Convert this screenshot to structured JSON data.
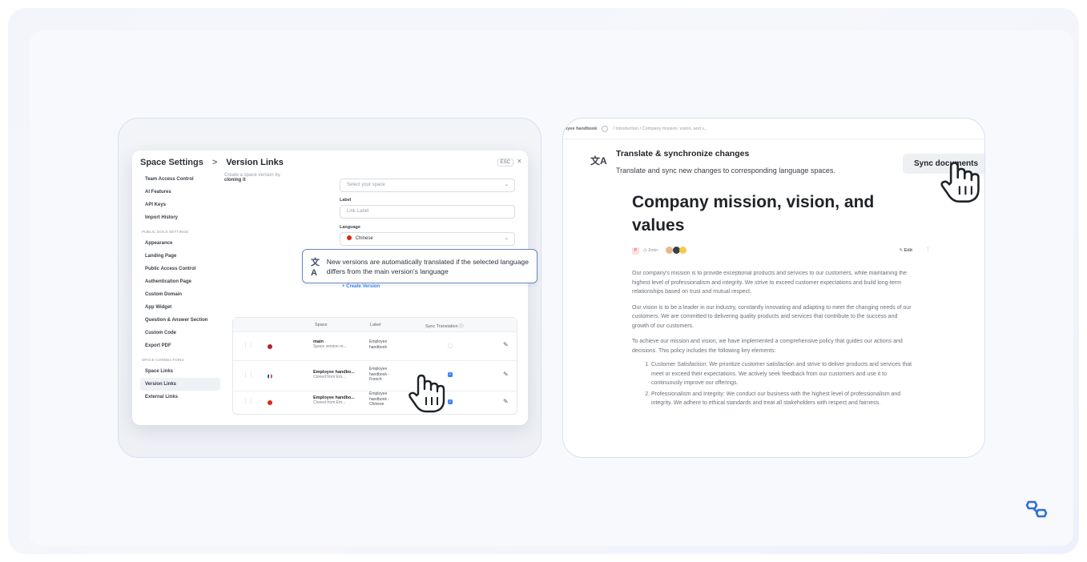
{
  "left": {
    "header": {
      "title": "Space Settings",
      "separator": ">",
      "subtitle": "Version Links",
      "esc": "ESC",
      "close": "×"
    },
    "sidebar": {
      "items_top": [
        "Team Access Control",
        "AI Features",
        "API Keys",
        "Import History"
      ],
      "group_public": "PUBLIC DOCS SETTINGS",
      "items_public": [
        "Appearance",
        "Landing Page",
        "Public Access Control",
        "Authentication Page",
        "Custom Domain",
        "App Widget",
        "Question & Answer Section",
        "Custom Code",
        "Export PDF"
      ],
      "group_connections": "SPACE CONNECTIONS",
      "items_connections": [
        "Space Links",
        "Version Links",
        "External Links"
      ]
    },
    "form": {
      "intro_faded": "Create a space version by",
      "intro": "cloning it",
      "space_placeholder": "Select your space",
      "label_title": "Label",
      "label_placeholder": "Link Label",
      "language_title": "Language",
      "language_value": "Chinese",
      "create_button": "+ Create Version"
    },
    "callout": {
      "text": "New versions are automatically translated if the selected language differs from the main version's language"
    },
    "table": {
      "headers": {
        "space": "Space",
        "label": "Label",
        "sync": "Sync Translation ⓘ"
      },
      "rows": [
        {
          "flag_color": "#b22234",
          "name": "main",
          "sub": "Space version re...",
          "label": "Employee handbook",
          "sync": false
        },
        {
          "flag_color": "#0055a4",
          "name": "Employee handbo...",
          "sub": "Cloned from Em...",
          "label": "Employee handbook - French",
          "sync": true
        },
        {
          "flag_color": "#de2910",
          "name": "Employee handbo...",
          "sub": "Cloned from Em...",
          "label": "Employee handbook - Chinese",
          "sync": true
        }
      ]
    }
  },
  "right": {
    "breadcrumb": {
      "first": "oyee handbook",
      "rest": "/ Introduction  / Company mission, vision, and v..."
    },
    "sync": {
      "title": "Translate & synchronize changes",
      "description": "Translate and sync new changes to corresponding language spaces.",
      "button": "Sync documents"
    },
    "doc": {
      "title": "Company mission, vision, and values",
      "badge": "P",
      "time": "◷ 2min",
      "edit": "✎ Edit",
      "more": "⋮",
      "para1": "Our company's mission is to provide exceptional products and services to our customers, while maintaining the highest level of professionalism and integrity. We strive to exceed customer expectations and build long-term relationships based on trust and mutual respect.",
      "para2": "Our vision is to be a leader in our industry, constantly innovating and adapting to meet the changing needs of our customers. We are committed to delivering quality products and services that contribute to the success and growth of our customers.",
      "para3": "To achieve our mission and vision, we have implemented a comprehensive policy that guides our actions and decisions. This policy includes the following key elements:",
      "list": [
        "Customer Satisfaction: We prioritize customer satisfaction and strive to deliver products and services that meet or exceed their expectations. We actively seek feedback from our customers and use it to continuously improve our offerings.",
        "Professionalism and Integrity: We conduct our business with the highest level of professionalism and integrity. We adhere to ethical standards and treat all stakeholders with respect and fairness."
      ]
    }
  },
  "colors": {
    "accent": "#3b82f6",
    "callout_border": "#6a86c4",
    "frame_border": "#d7e1f4"
  },
  "icons": {
    "translate": "translate-icon",
    "hand_cursor": "hand-cursor-icon",
    "brand": "brand-logo-icon"
  }
}
